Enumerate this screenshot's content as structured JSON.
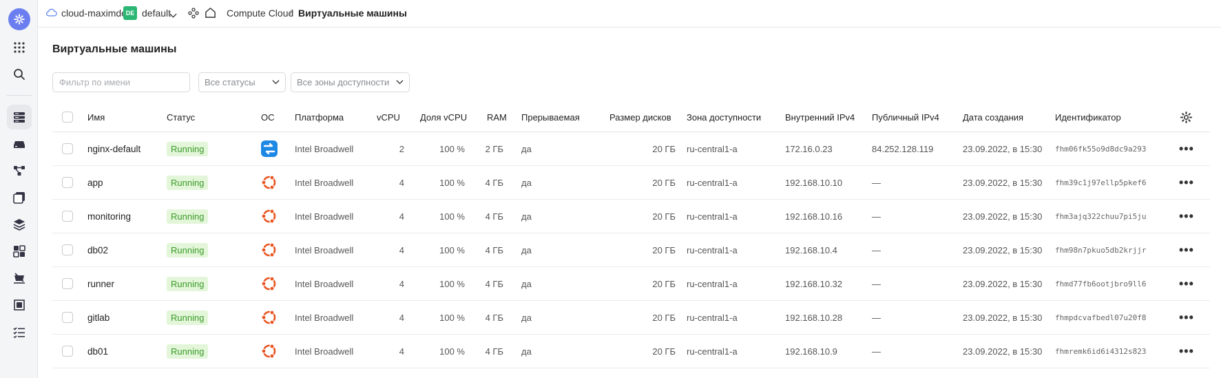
{
  "topbar": {
    "cloud_name": "cloud-maximde...",
    "folder_badge": "DE",
    "folder_name": "default",
    "breadcrumb_service": "Compute Cloud",
    "breadcrumb_sep": "/",
    "breadcrumb_page": "Виртуальные машины"
  },
  "page": {
    "title": "Виртуальные машины",
    "filter_placeholder": "Фильтр по имени",
    "status_select": "Все статусы",
    "zone_select": "Все зоны доступности"
  },
  "table": {
    "columns": {
      "name": "Имя",
      "status": "Статус",
      "os": "ОС",
      "platform": "Платформа",
      "vcpu": "vCPU",
      "vcpu_share": "Доля vCPU",
      "ram": "RAM",
      "preemptible": "Прерываемая",
      "disk_size": "Размер дисков",
      "zone": "Зона доступности",
      "internal_ip": "Внутренний IPv4",
      "public_ip": "Публичный IPv4",
      "created": "Дата создания",
      "id": "Идентификатор"
    },
    "rows": [
      {
        "name": "nginx-default",
        "status": "Running",
        "os": "nginx",
        "platform": "Intel Broadwell",
        "vcpu": "2",
        "vcpu_share": "100 %",
        "ram": "2 ГБ",
        "preemptible": "да",
        "disk": "20 ГБ",
        "zone": "ru-central1-a",
        "internal_ip": "172.16.0.23",
        "public_ip": "84.252.128.119",
        "created": "23.09.2022, в 15:30",
        "id": "fhm06fk55o9d8dc9a293"
      },
      {
        "name": "app",
        "status": "Running",
        "os": "ubuntu",
        "platform": "Intel Broadwell",
        "vcpu": "4",
        "vcpu_share": "100 %",
        "ram": "4 ГБ",
        "preemptible": "да",
        "disk": "20 ГБ",
        "zone": "ru-central1-a",
        "internal_ip": "192.168.10.10",
        "public_ip": "—",
        "created": "23.09.2022, в 15:30",
        "id": "fhm39c1j97ellp5pkef6"
      },
      {
        "name": "monitoring",
        "status": "Running",
        "os": "ubuntu",
        "platform": "Intel Broadwell",
        "vcpu": "4",
        "vcpu_share": "100 %",
        "ram": "4 ГБ",
        "preemptible": "да",
        "disk": "20 ГБ",
        "zone": "ru-central1-a",
        "internal_ip": "192.168.10.16",
        "public_ip": "—",
        "created": "23.09.2022, в 15:30",
        "id": "fhm3ajq322chuu7pi5ju"
      },
      {
        "name": "db02",
        "status": "Running",
        "os": "ubuntu",
        "platform": "Intel Broadwell",
        "vcpu": "4",
        "vcpu_share": "100 %",
        "ram": "4 ГБ",
        "preemptible": "да",
        "disk": "20 ГБ",
        "zone": "ru-central1-a",
        "internal_ip": "192.168.10.4",
        "public_ip": "—",
        "created": "23.09.2022, в 15:30",
        "id": "fhm98n7pkuo5db2krjjr"
      },
      {
        "name": "runner",
        "status": "Running",
        "os": "ubuntu",
        "platform": "Intel Broadwell",
        "vcpu": "4",
        "vcpu_share": "100 %",
        "ram": "4 ГБ",
        "preemptible": "да",
        "disk": "20 ГБ",
        "zone": "ru-central1-a",
        "internal_ip": "192.168.10.32",
        "public_ip": "—",
        "created": "23.09.2022, в 15:30",
        "id": "fhmd77fb6ootjbro9ll6"
      },
      {
        "name": "gitlab",
        "status": "Running",
        "os": "ubuntu",
        "platform": "Intel Broadwell",
        "vcpu": "4",
        "vcpu_share": "100 %",
        "ram": "4 ГБ",
        "preemptible": "да",
        "disk": "20 ГБ",
        "zone": "ru-central1-a",
        "internal_ip": "192.168.10.28",
        "public_ip": "—",
        "created": "23.09.2022, в 15:30",
        "id": "fhmpdcvafbedl07u20f8"
      },
      {
        "name": "db01",
        "status": "Running",
        "os": "ubuntu",
        "platform": "Intel Broadwell",
        "vcpu": "4",
        "vcpu_share": "100 %",
        "ram": "4 ГБ",
        "preemptible": "да",
        "disk": "20 ГБ",
        "zone": "ru-central1-a",
        "internal_ip": "192.168.10.9",
        "public_ip": "—",
        "created": "23.09.2022, в 15:30",
        "id": "fhmremk6id6i4312s823"
      }
    ]
  },
  "colors": {
    "status_bg": "#e3f6d9",
    "status_text": "#3a9b2a",
    "ubuntu_orange": "#e95420",
    "nginx_blue": "#1e88e5",
    "brand_purple": "#6b7ef0",
    "folder_green": "#2bb673"
  },
  "icons": [
    "gear-icon",
    "apps-grid-icon",
    "search-icon",
    "server-list-icon",
    "disk-icon",
    "network-icon",
    "images-icon",
    "layers-icon",
    "groups-icon",
    "snapshot-icon",
    "placement-icon",
    "tasks-icon",
    "cloud-icon",
    "nodes-icon",
    "home-icon",
    "chevron-down-icon",
    "more-dots-icon",
    "table-settings-icon"
  ]
}
